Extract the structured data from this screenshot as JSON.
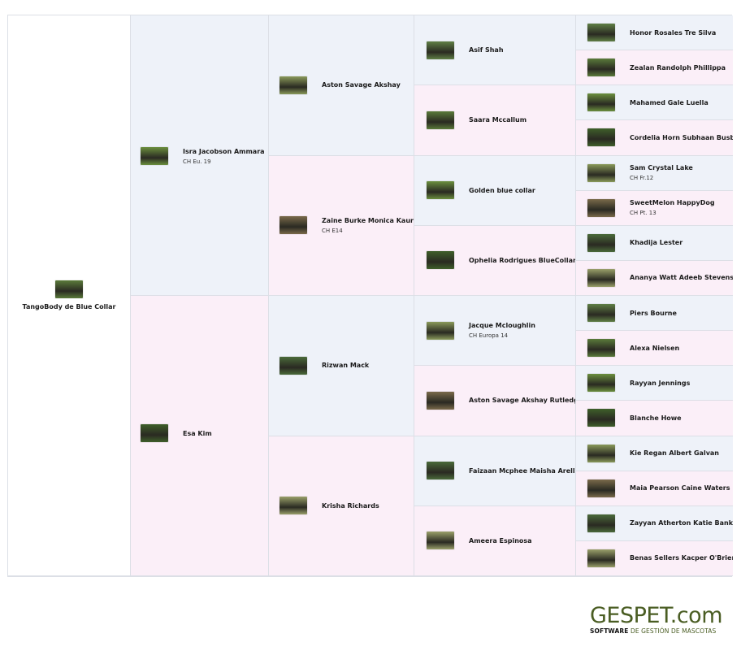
{
  "colors": {
    "sire_bg": "#eef2f9",
    "dam_bg": "#fbeff8",
    "border": "#dcdfe6",
    "brand": "#4a5d23"
  },
  "subject": {
    "name": "TangoBody de Blue Collar",
    "title": ""
  },
  "gen1": [
    {
      "name": "Isra Jacobson Ammara",
      "title": "CH Eu. 19"
    },
    {
      "name": "Esa Kim",
      "title": ""
    }
  ],
  "gen2": [
    {
      "name": "Aston Savage Akshay",
      "title": ""
    },
    {
      "name": "Zaine Burke Monica Kaur",
      "title": "CH E14"
    },
    {
      "name": "Rizwan Mack",
      "title": ""
    },
    {
      "name": "Krisha Richards",
      "title": ""
    }
  ],
  "gen3": [
    {
      "name": "Asif Shah",
      "title": ""
    },
    {
      "name": "Saara Mccallum",
      "title": ""
    },
    {
      "name": "Golden blue collar",
      "title": ""
    },
    {
      "name": "Ophelia Rodrigues BlueCollar",
      "title": ""
    },
    {
      "name": "Jacque Mcloughlin",
      "title": "CH Europa 14"
    },
    {
      "name": "Aston Savage Akshay Rutledge",
      "title": ""
    },
    {
      "name": "Faizaan Mcphee Maisha Arellano",
      "title": ""
    },
    {
      "name": "Ameera Espinosa",
      "title": ""
    }
  ],
  "gen4": [
    {
      "name": "Honor Rosales Tre Silva",
      "title": ""
    },
    {
      "name": "Zealan Randolph Phillippa",
      "title": ""
    },
    {
      "name": "Mahamed Gale Luella",
      "title": ""
    },
    {
      "name": "Cordelia Horn Subhaan Busby",
      "title": ""
    },
    {
      "name": "Sam Crystal Lake",
      "title": "CH Fr.12"
    },
    {
      "name": "SweetMelon HappyDog",
      "title": "CH Pt. 13"
    },
    {
      "name": "Khadija Lester",
      "title": ""
    },
    {
      "name": "Ananya Watt Adeeb Stevens",
      "title": ""
    },
    {
      "name": "Piers Bourne",
      "title": ""
    },
    {
      "name": "Alexa Nielsen",
      "title": ""
    },
    {
      "name": "Rayyan Jennings",
      "title": ""
    },
    {
      "name": "Blanche Howe",
      "title": ""
    },
    {
      "name": "Kie Regan Albert Galvan",
      "title": ""
    },
    {
      "name": "Maia Pearson Caine Waters",
      "title": ""
    },
    {
      "name": "Zayyan Atherton Katie Banks",
      "title": ""
    },
    {
      "name": "Benas Sellers Kacper O'Brien",
      "title": ""
    }
  ],
  "logo": {
    "brand": "GESPET.com",
    "tag_bold": "SOFTWARE",
    "tag_rest": " DE GESTIÓN DE MASCOTAS"
  }
}
